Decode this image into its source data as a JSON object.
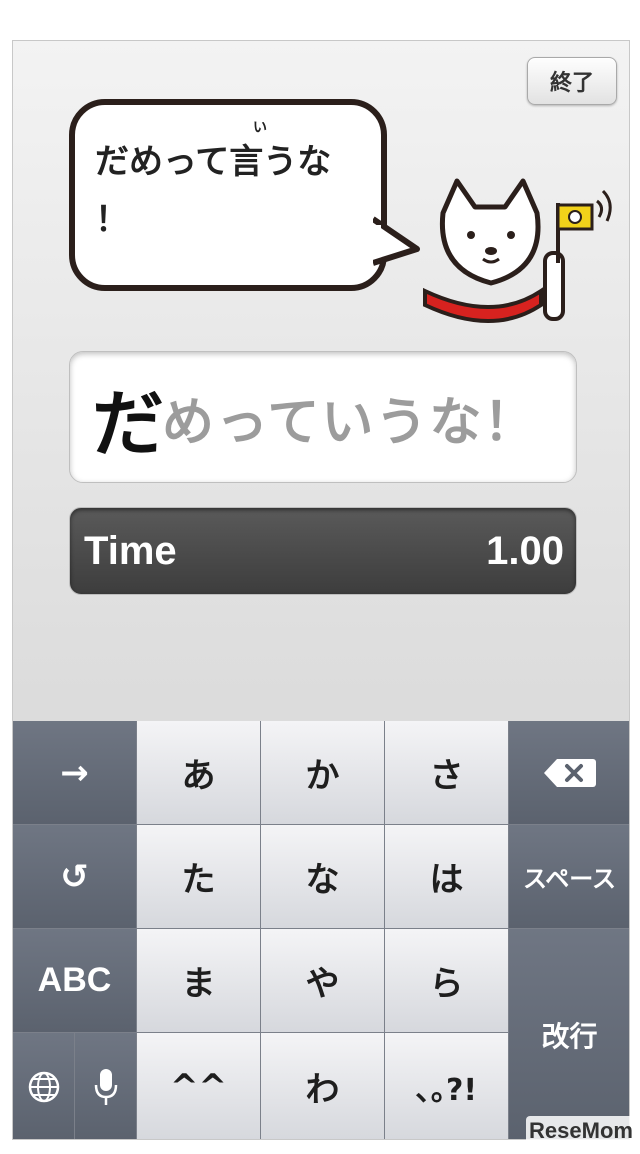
{
  "header": {
    "end_label": "終了"
  },
  "bubble": {
    "line1": "だめって言うな",
    "line2": "！",
    "ruby": "い"
  },
  "mascot": {
    "flag_color": "#f2d21a",
    "collar_color": "#d7221f"
  },
  "answer": {
    "typed": "だ",
    "remaining": "めっていうな！"
  },
  "timer": {
    "label": "Time",
    "value": "1.00"
  },
  "keyboard": {
    "rows": [
      [
        "→",
        "あ",
        "か",
        "さ",
        "⌫"
      ],
      [
        "↺",
        "た",
        "な",
        "は",
        "スペース"
      ],
      [
        "ABC",
        "ま",
        "や",
        "ら",
        "改行"
      ],
      [
        "🌐",
        "🎤",
        "^^",
        "わ_",
        "､｡?!"
      ]
    ],
    "arrow_label": "→",
    "undo_label": "↺",
    "abc_label": "ABC",
    "space_label": "スペース",
    "return_label": "改行",
    "kana": {
      "a": "あ",
      "ka": "か",
      "sa": "さ",
      "ta": "た",
      "na": "な",
      "ha": "は",
      "ma": "ま",
      "ya": "や",
      "ra": "ら",
      "emoji": "^^",
      "wa": "わ",
      "punct": "､｡?!"
    }
  },
  "watermark": "ReseMom"
}
